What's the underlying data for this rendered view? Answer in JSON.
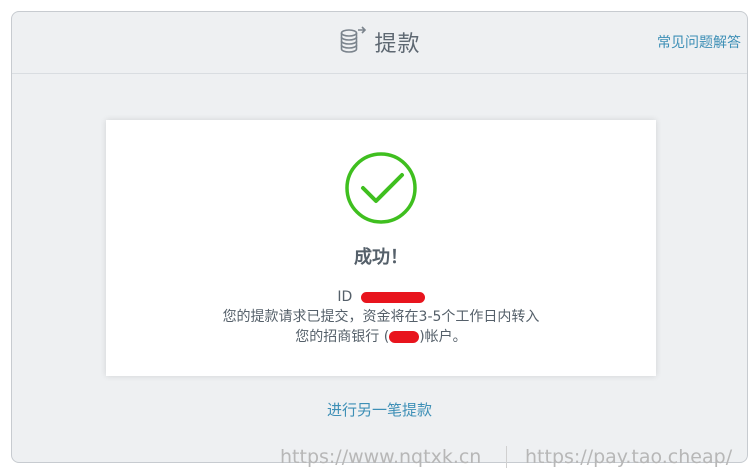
{
  "header": {
    "title": "提款",
    "faq_link": "常见问题解答",
    "title_icon": "coin-stack-icon"
  },
  "card": {
    "status_icon": "check-circle-icon",
    "success_text": "成功！",
    "id_label": "ID",
    "message_line1": "您的提款请求已提交，资金将在3-5个工作日内转入",
    "message_line2_prefix": "您的招商银行 (",
    "message_line2_suffix": ")帐户。"
  },
  "actions": {
    "another_withdrawal": "进行另一笔提款"
  },
  "watermarks": {
    "left": "https://www.nqtxk.cn",
    "right": "https://pay.tao.cheap/"
  },
  "colors": {
    "accent_link": "#3d8fb6",
    "success_green": "#3fbf1f",
    "redaction": "#e8141d"
  }
}
